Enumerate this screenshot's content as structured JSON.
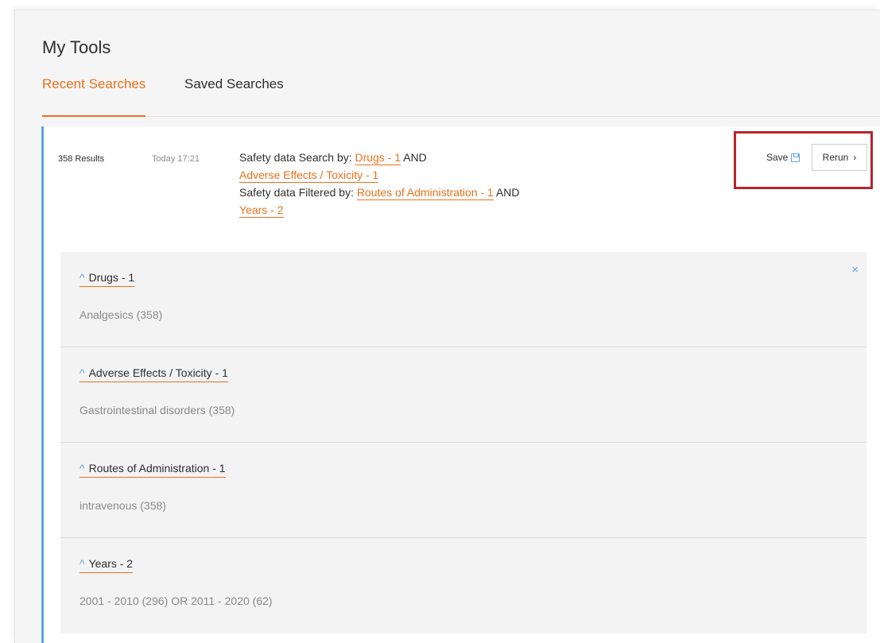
{
  "page": {
    "title": "My Tools"
  },
  "tabs": [
    {
      "label": "Recent Searches",
      "active": true
    },
    {
      "label": "Saved Searches",
      "active": false
    }
  ],
  "result": {
    "count": "358 Results",
    "time": "Today 17:21",
    "query": {
      "search_prefix": "Safety data Search by:",
      "search_terms": [
        "Drugs - 1",
        "Adverse Effects / Toxicity - 1"
      ],
      "filter_prefix": "Safety data Filtered by:",
      "filter_terms": [
        "Routes of Administration - 1",
        "Years - 2"
      ],
      "operator": "AND"
    },
    "actions": {
      "save_label": "Save",
      "rerun_label": "Rerun"
    }
  },
  "filters": {
    "close_icon": "×",
    "sections": [
      {
        "heading": "Drugs - 1",
        "value": "Analgesics (358)"
      },
      {
        "heading": "Adverse Effects / Toxicity - 1",
        "value": "Gastrointestinal disorders (358)"
      },
      {
        "heading": "Routes of Administration - 1",
        "value": "intravenous (358)"
      },
      {
        "heading": "Years - 2",
        "value": "2001 - 2010 (296) OR 2011 - 2020 (62)"
      }
    ]
  },
  "icons": {
    "caret": "caret-up-icon",
    "save": "save-disk-icon",
    "rerun": "chevron-right-icon",
    "close": "close-icon"
  },
  "colors": {
    "accent": "#e9711c",
    "highlight_border": "#b5262b",
    "card_stripe": "#5aa5e6"
  }
}
